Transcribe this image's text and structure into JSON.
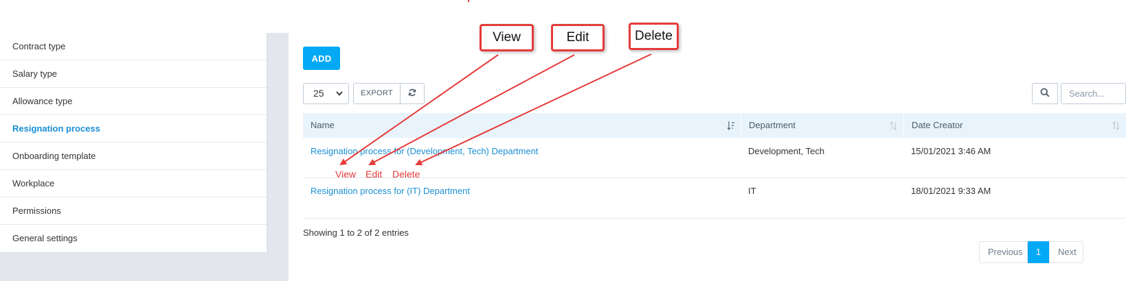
{
  "sidebar": {
    "items": [
      {
        "label": "Contract type",
        "active": false
      },
      {
        "label": "Salary type",
        "active": false
      },
      {
        "label": "Allowance type",
        "active": false
      },
      {
        "label": "Resignation process",
        "active": true
      },
      {
        "label": "Onboarding template",
        "active": false
      },
      {
        "label": "Workplace",
        "active": false
      },
      {
        "label": "Permissions",
        "active": false
      },
      {
        "label": "General settings",
        "active": false
      }
    ]
  },
  "toolbar": {
    "add_label": "ADD",
    "page_length": "25",
    "export_label": "EXPORT",
    "search_placeholder": "Search..."
  },
  "table": {
    "columns": [
      "Name",
      "Department",
      "Date Creator"
    ],
    "rows": [
      {
        "name": "Resignation process for (Development, Tech) Department",
        "department": "Development, Tech",
        "date": "15/01/2021 3:46 AM"
      },
      {
        "name": "Resignation process for (IT) Department",
        "department": "IT",
        "date": "18/01/2021 9:33 AM"
      }
    ]
  },
  "footer": {
    "info": "Showing 1 to 2 of 2 entries",
    "previous": "Previous",
    "current_page": "1",
    "next": "Next"
  },
  "annotations": {
    "callouts": [
      "View",
      "Edit",
      "Delete"
    ],
    "row_actions": [
      "View",
      "Edit",
      "Delete"
    ]
  },
  "colors": {
    "accent": "#03a9f4",
    "link": "#1a8fd4",
    "annotation": "#e53a3a",
    "header_bg": "#e9f3fb"
  },
  "icons": {
    "select": "chevron-down-icon",
    "reload": "refresh-icon",
    "search": "search-icon",
    "sort": "sort-icon"
  }
}
